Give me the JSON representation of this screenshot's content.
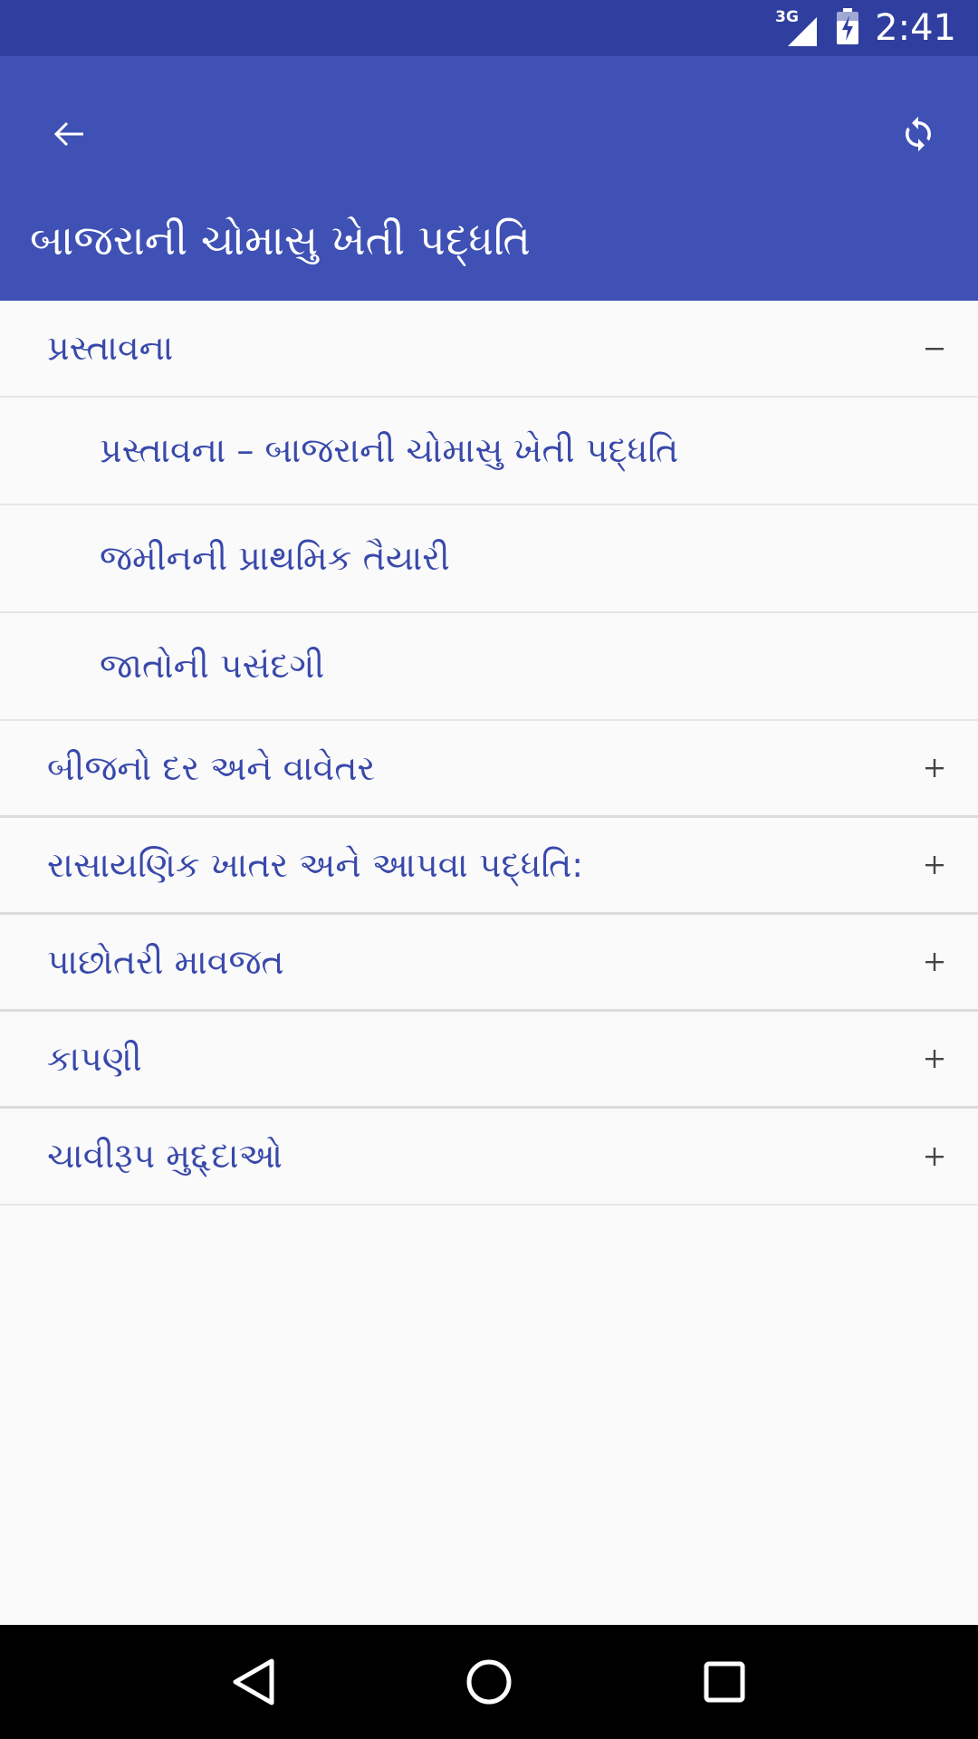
{
  "status_bar": {
    "network": "3G",
    "time": "2:41"
  },
  "app_bar": {
    "title": "બાજરાની ચોમાસુ ખેતી પદ્ધતિ",
    "back_icon": "arrow-back-icon",
    "refresh_icon": "refresh-icon",
    "background_color": "#3f51b5",
    "status_color": "#303f9f"
  },
  "sections": [
    {
      "label": "પ્રસ્તાવના",
      "expanded": true,
      "toggle": "−",
      "items": [
        {
          "label": "પ્રસ્તાવના – બાજરાની ચોમાસુ ખેતી પદ્ધતિ"
        },
        {
          "label": "જમીનની પ્રાથમિક તૈયારી"
        },
        {
          "label": "જાતોની પસંદગી"
        }
      ]
    },
    {
      "label": "બીજનો દર અને   વાવેતર",
      "expanded": false,
      "toggle": "+"
    },
    {
      "label": "રાસાયણિક ખાતર અને આપવા પદ્ધતિ:",
      "expanded": false,
      "toggle": "+"
    },
    {
      "label": "પાછોતરી માવજત",
      "expanded": false,
      "toggle": "+"
    },
    {
      "label": "કાપણી",
      "expanded": false,
      "toggle": "+"
    },
    {
      "label": "ચાવીરૂપ  મુદ્દ્દાઓ",
      "expanded": false,
      "toggle": "+"
    }
  ],
  "accent_color": "#3949ab"
}
